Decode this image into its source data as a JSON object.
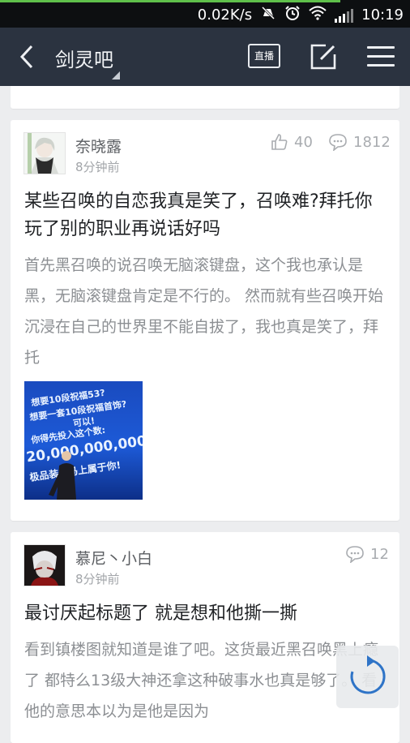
{
  "status_bar": {
    "speed": "0.02K/s",
    "time": "10:19",
    "icons": [
      "mute-icon",
      "alarm-icon",
      "wifi-icon",
      "signal-icon"
    ]
  },
  "nav": {
    "title": "剑灵吧",
    "live_label": "直播"
  },
  "posts": [
    {
      "author": "奈晓露",
      "time": "8分钟前",
      "likes": "40",
      "comments": "1812",
      "title": "某些召唤的自恋我真是笑了，召唤难?拜托你玩了别的职业再说话好吗",
      "excerpt": "首先黑召唤的说召唤无脑滚键盘，这个我也承认是黑，无脑滚键盘肯定是不行的。 然而就有些召唤开始沉浸在自己的世界里不能自拔了，我也真是笑了，拜托",
      "image_text": {
        "line1": "想要10段祝福53?",
        "line2": "想要一套10段祝福首饰?",
        "line3": "可以!",
        "line4": "你得先投入这个数:",
        "line5": "20,000,000,000",
        "line6": "极品装备马上属于你!"
      }
    },
    {
      "author": "慕尼丶小白",
      "time": "8分钟前",
      "comments": "12",
      "title": "最讨厌起标题了 就是想和他撕一撕",
      "excerpt": "看到镇楼图就知道是谁了吧。这货最近黑召唤黑上瘾了 都特么13级大神还拿这种破事水也真是够了。 看他的意思本以为是他是因为"
    }
  ],
  "colors": {
    "nav_bg": "#2b3340",
    "status_bg": "#0d0f11",
    "page_bg": "#ecedef",
    "progress": "#5fc04b"
  }
}
